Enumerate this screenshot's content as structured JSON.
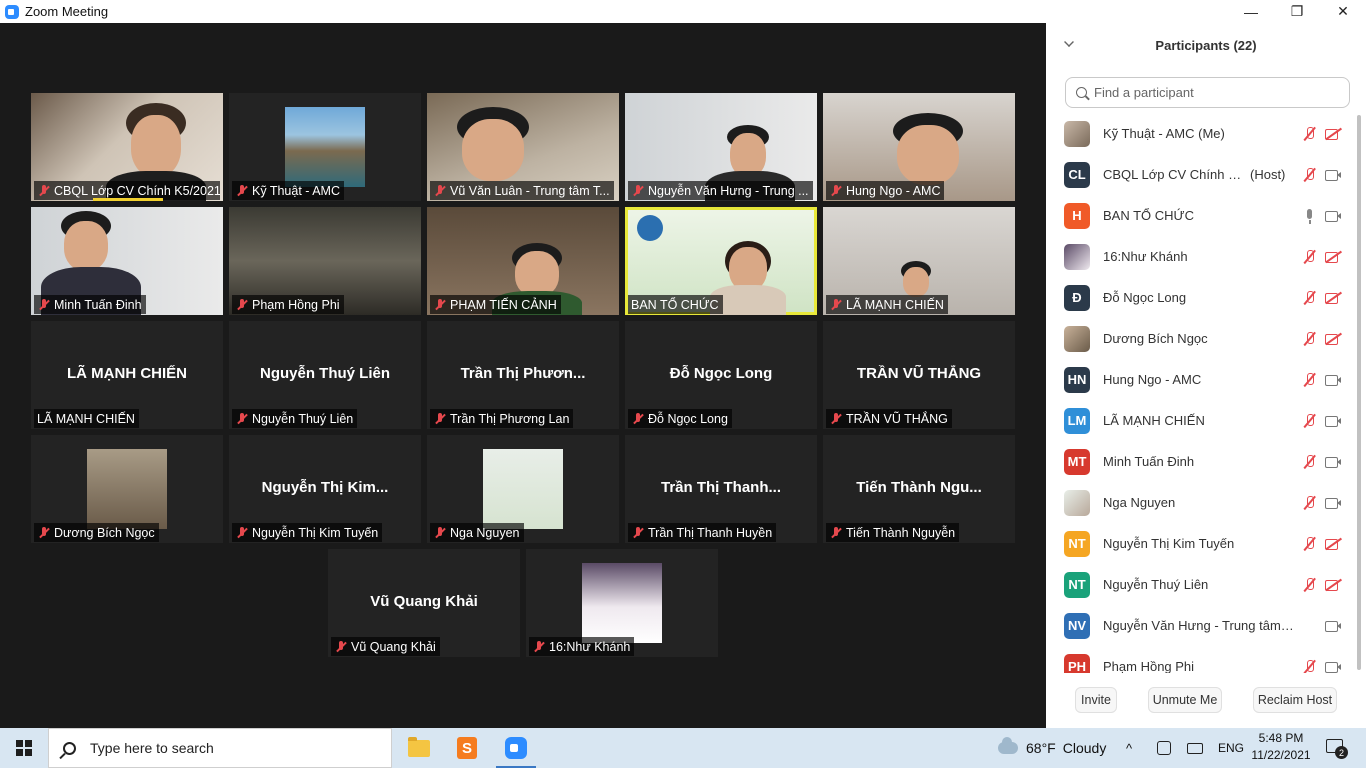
{
  "window": {
    "title": "Zoom Meeting",
    "minimize": "—",
    "maximize": "❐",
    "close": "✕"
  },
  "tiles": [
    {
      "label": "CBQL Lớp CV Chính K5/2021"
    },
    {
      "label": "Kỹ Thuật - AMC"
    },
    {
      "label": "Vũ Văn Luân - Trung tâm T..."
    },
    {
      "label": "Nguyễn Văn Hưng - Trung ..."
    },
    {
      "label": "Hung Ngo - AMC"
    },
    {
      "label": "Minh Tuấn Đinh"
    },
    {
      "label": "Phạm Hồng Phi"
    },
    {
      "label": "PHẠM TIẾN CẢNH"
    },
    {
      "label": "BAN TỔ CHỨC"
    },
    {
      "label": "LÃ MẠNH CHIẾN"
    },
    {
      "center": "LÃ MẠNH CHIẾN",
      "label": "LÃ MẠNH CHIẾN"
    },
    {
      "center": "Nguyễn Thuý Liên",
      "label": "Nguyễn Thuý Liên"
    },
    {
      "center": "Trần Thị Phươn...",
      "label": "Trần Thị Phương Lan"
    },
    {
      "center": "Đỗ Ngọc Long",
      "label": "Đỗ Ngọc Long"
    },
    {
      "center": "TRẦN VŨ THẮNG",
      "label": "TRẦN VŨ THẮNG"
    },
    {
      "label": "Dương Bích Ngọc"
    },
    {
      "center": "Nguyễn Thị Kim...",
      "label": "Nguyễn Thị Kim Tuyến"
    },
    {
      "label": "Nga Nguyen"
    },
    {
      "center": "Trần Thị Thanh...",
      "label": "Trần Thị Thanh Huyền"
    },
    {
      "center": "Tiến Thành Ngu...",
      "label": "Tiến Thành Nguyễn"
    },
    {
      "center": "Vũ Quang Khải",
      "label": "Vũ Quang Khải"
    },
    {
      "label": "16:Như Khánh"
    }
  ],
  "panel": {
    "title": "Participants (22)",
    "search_placeholder": "Find a participant",
    "participants": [
      {
        "name": "Kỹ Thuật - AMC (Me)",
        "avatar": "",
        "color": "",
        "tag": ""
      },
      {
        "name": "CBQL Lớp CV Chính K5/2...",
        "avatar": "CL",
        "color": "#2b3a4a",
        "tag": "(Host)"
      },
      {
        "name": "BAN TỔ CHỨC",
        "avatar": "H",
        "color": "#f05a28",
        "tag": ""
      },
      {
        "name": "16:Như Khánh",
        "avatar": "",
        "color": "",
        "tag": ""
      },
      {
        "name": "Đỗ Ngọc Long",
        "avatar": "Đ",
        "color": "#2b3a4a",
        "tag": ""
      },
      {
        "name": "Dương Bích Ngọc",
        "avatar": "",
        "color": "",
        "tag": ""
      },
      {
        "name": "Hung Ngo - AMC",
        "avatar": "HN",
        "color": "#2b3a4a",
        "tag": ""
      },
      {
        "name": "LÃ MẠNH CHIẾN",
        "avatar": "LM",
        "color": "#2f8fd8",
        "tag": ""
      },
      {
        "name": "Minh Tuấn Đinh",
        "avatar": "MT",
        "color": "#d7392e",
        "tag": ""
      },
      {
        "name": "Nga Nguyen",
        "avatar": "",
        "color": "",
        "tag": ""
      },
      {
        "name": "Nguyễn Thị Kim Tuyến",
        "avatar": "NT",
        "color": "#f5a623",
        "tag": ""
      },
      {
        "name": "Nguyễn Thuý Liên",
        "avatar": "NT",
        "color": "#1aa27a",
        "tag": ""
      },
      {
        "name": "Nguyễn Văn Hưng - Trung tâm ...",
        "avatar": "NV",
        "color": "#2f6fb5",
        "tag": ""
      },
      {
        "name": "Phạm Hồng Phi",
        "avatar": "PH",
        "color": "#d7392e",
        "tag": ""
      }
    ],
    "buttons": {
      "invite": "Invite",
      "unmute": "Unmute Me",
      "reclaim": "Reclaim Host"
    }
  },
  "taskbar": {
    "search_placeholder": "Type here to search",
    "weather_temp": "68°F",
    "weather_text": "Cloudy",
    "tray_caret": "^",
    "language": "ENG",
    "time": "5:48 PM",
    "date": "11/22/2021",
    "notification_count": "2",
    "sublime_glyph": "S"
  }
}
